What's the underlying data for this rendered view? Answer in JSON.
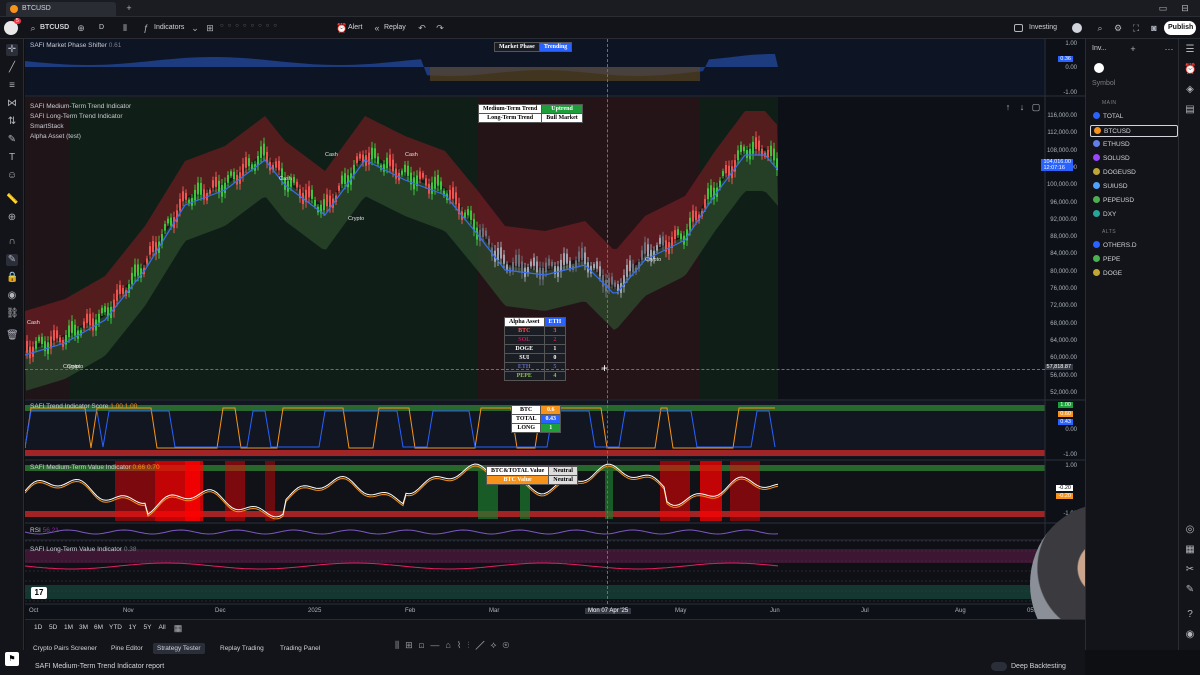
{
  "browser": {
    "tab_title": "BTCUSD"
  },
  "toolbar": {
    "symbol": "BTCUSD",
    "interval": "D",
    "indicators": "Indicators",
    "alert": "Alert",
    "replay": "Replay",
    "investing": "Investing",
    "publish": "Publish",
    "notification_count": "5"
  },
  "panes": {
    "market_phase": {
      "label": "SAFI Market Phase Shifter",
      "value": "0.61",
      "table_label": "Market Phase",
      "table_value": "Trending",
      "axis": [
        "1.00",
        "0.36",
        "0.00",
        "-1.00"
      ]
    },
    "main": {
      "indicators": [
        "SAFI Medium-Term Trend Indicator",
        "SAFI Long-Term Trend Indicator",
        "SmartStack",
        "Alpha Asset (test)"
      ],
      "trend_table": [
        [
          "Medium-Term Trend",
          "Uptrend"
        ],
        [
          "Long-Term Trend",
          "Bull Market"
        ]
      ],
      "price_axis": [
        "116,000.00",
        "112,000.00",
        "108,000.00",
        "104,000.00",
        "100,000.00",
        "96,000.00",
        "92,000.00",
        "88,000.00",
        "84,000.00",
        "80,000.00",
        "76,000.00",
        "72,000.00",
        "68,000.00",
        "64,000.00",
        "60,000.00",
        "56,000.00",
        "52,000.00"
      ],
      "current_price": "104,016.00",
      "current_time": "12:07:16",
      "crosshair_price": "57,818.87",
      "chart_labels": [
        {
          "text": "Cash"
        },
        {
          "text": "Cash"
        },
        {
          "text": "Cash"
        },
        {
          "text": "Crypto"
        },
        {
          "text": "Crypto"
        },
        {
          "text": "Crypto"
        },
        {
          "text": "Cash"
        },
        {
          "text": "Crypto"
        }
      ],
      "alpha_table": {
        "header": [
          "Alpha Asset",
          "ETH"
        ],
        "rows": [
          [
            "BTC",
            "3"
          ],
          [
            "SOL",
            "2"
          ],
          [
            "DOGE",
            "1"
          ],
          [
            "SUI",
            "0"
          ],
          [
            "ETH",
            "5"
          ],
          [
            "PEPE",
            "4"
          ]
        ]
      }
    },
    "trend_score": {
      "label": "SAFI Trend Indicator Score",
      "values": "1.00 1.00",
      "table": [
        [
          "BTC",
          "0.6"
        ],
        [
          "TOTAL",
          "0.43"
        ],
        [
          "LONG",
          "1"
        ]
      ],
      "axis": [
        "1.00",
        "0.60",
        "0.43",
        "0.00",
        "-1.00"
      ]
    },
    "mtv": {
      "label": "SAFI Medium-Term Value Indicator",
      "values": "0.66 0.70",
      "table": [
        [
          "BTC&TOTAL Value",
          "Neutral"
        ],
        [
          "BTC Value",
          "Neutral"
        ]
      ],
      "axis": [
        "1.00",
        "-0.20",
        "-0.20",
        "-1.00"
      ]
    },
    "rsi": {
      "label": "RSI",
      "value": "56.21"
    },
    "ltv": {
      "label": "SAFI Long-Term Value Indicator",
      "value": "0.38"
    }
  },
  "time_axis": [
    "Oct",
    "Nov",
    "Dec",
    "2025",
    "Feb",
    "Mar",
    "Mon 07 Apr '25",
    "May",
    "Jun",
    "Jul",
    "Aug"
  ],
  "time_clock": "05:56",
  "ranges": [
    "1D",
    "5D",
    "1M",
    "3M",
    "6M",
    "YTD",
    "1Y",
    "5Y",
    "All"
  ],
  "bottom_tabs": [
    "Crypto Pairs Screener",
    "Pine Editor",
    "Strategy Tester",
    "Replay Trading",
    "Trading Panel"
  ],
  "report_label": "SAFI Medium-Term Trend Indicator report",
  "deep_backtesting": "Deep Backtesting",
  "watchlist": {
    "title": "Inv...",
    "header": "Symbol",
    "sections": [
      {
        "name": "MAIN",
        "items": [
          {
            "symbol": "TOTAL",
            "color": "#2962ff"
          },
          {
            "symbol": "BTCUSD",
            "color": "#f7931a"
          },
          {
            "symbol": "ETHUSD",
            "color": "#627eea"
          },
          {
            "symbol": "SOLUSD",
            "color": "#9945ff"
          },
          {
            "symbol": "DOGEUSD",
            "color": "#c2a633"
          },
          {
            "symbol": "SUIUSD",
            "color": "#4da2ff"
          },
          {
            "symbol": "PEPEUSD",
            "color": "#4caf50"
          },
          {
            "symbol": "DXY",
            "color": "#26a69a"
          }
        ]
      },
      {
        "name": "ALTS",
        "items": [
          {
            "symbol": "OTHERS.D",
            "color": "#2962ff"
          },
          {
            "symbol": "PEPE",
            "color": "#4caf50"
          },
          {
            "symbol": "DOGE",
            "color": "#c2a633"
          }
        ]
      }
    ]
  },
  "colors": {
    "up": "#26a69a",
    "down": "#ef5350",
    "accent": "#2962ff",
    "green_band": "#1e3a24",
    "red_band": "#3a1c1f"
  }
}
